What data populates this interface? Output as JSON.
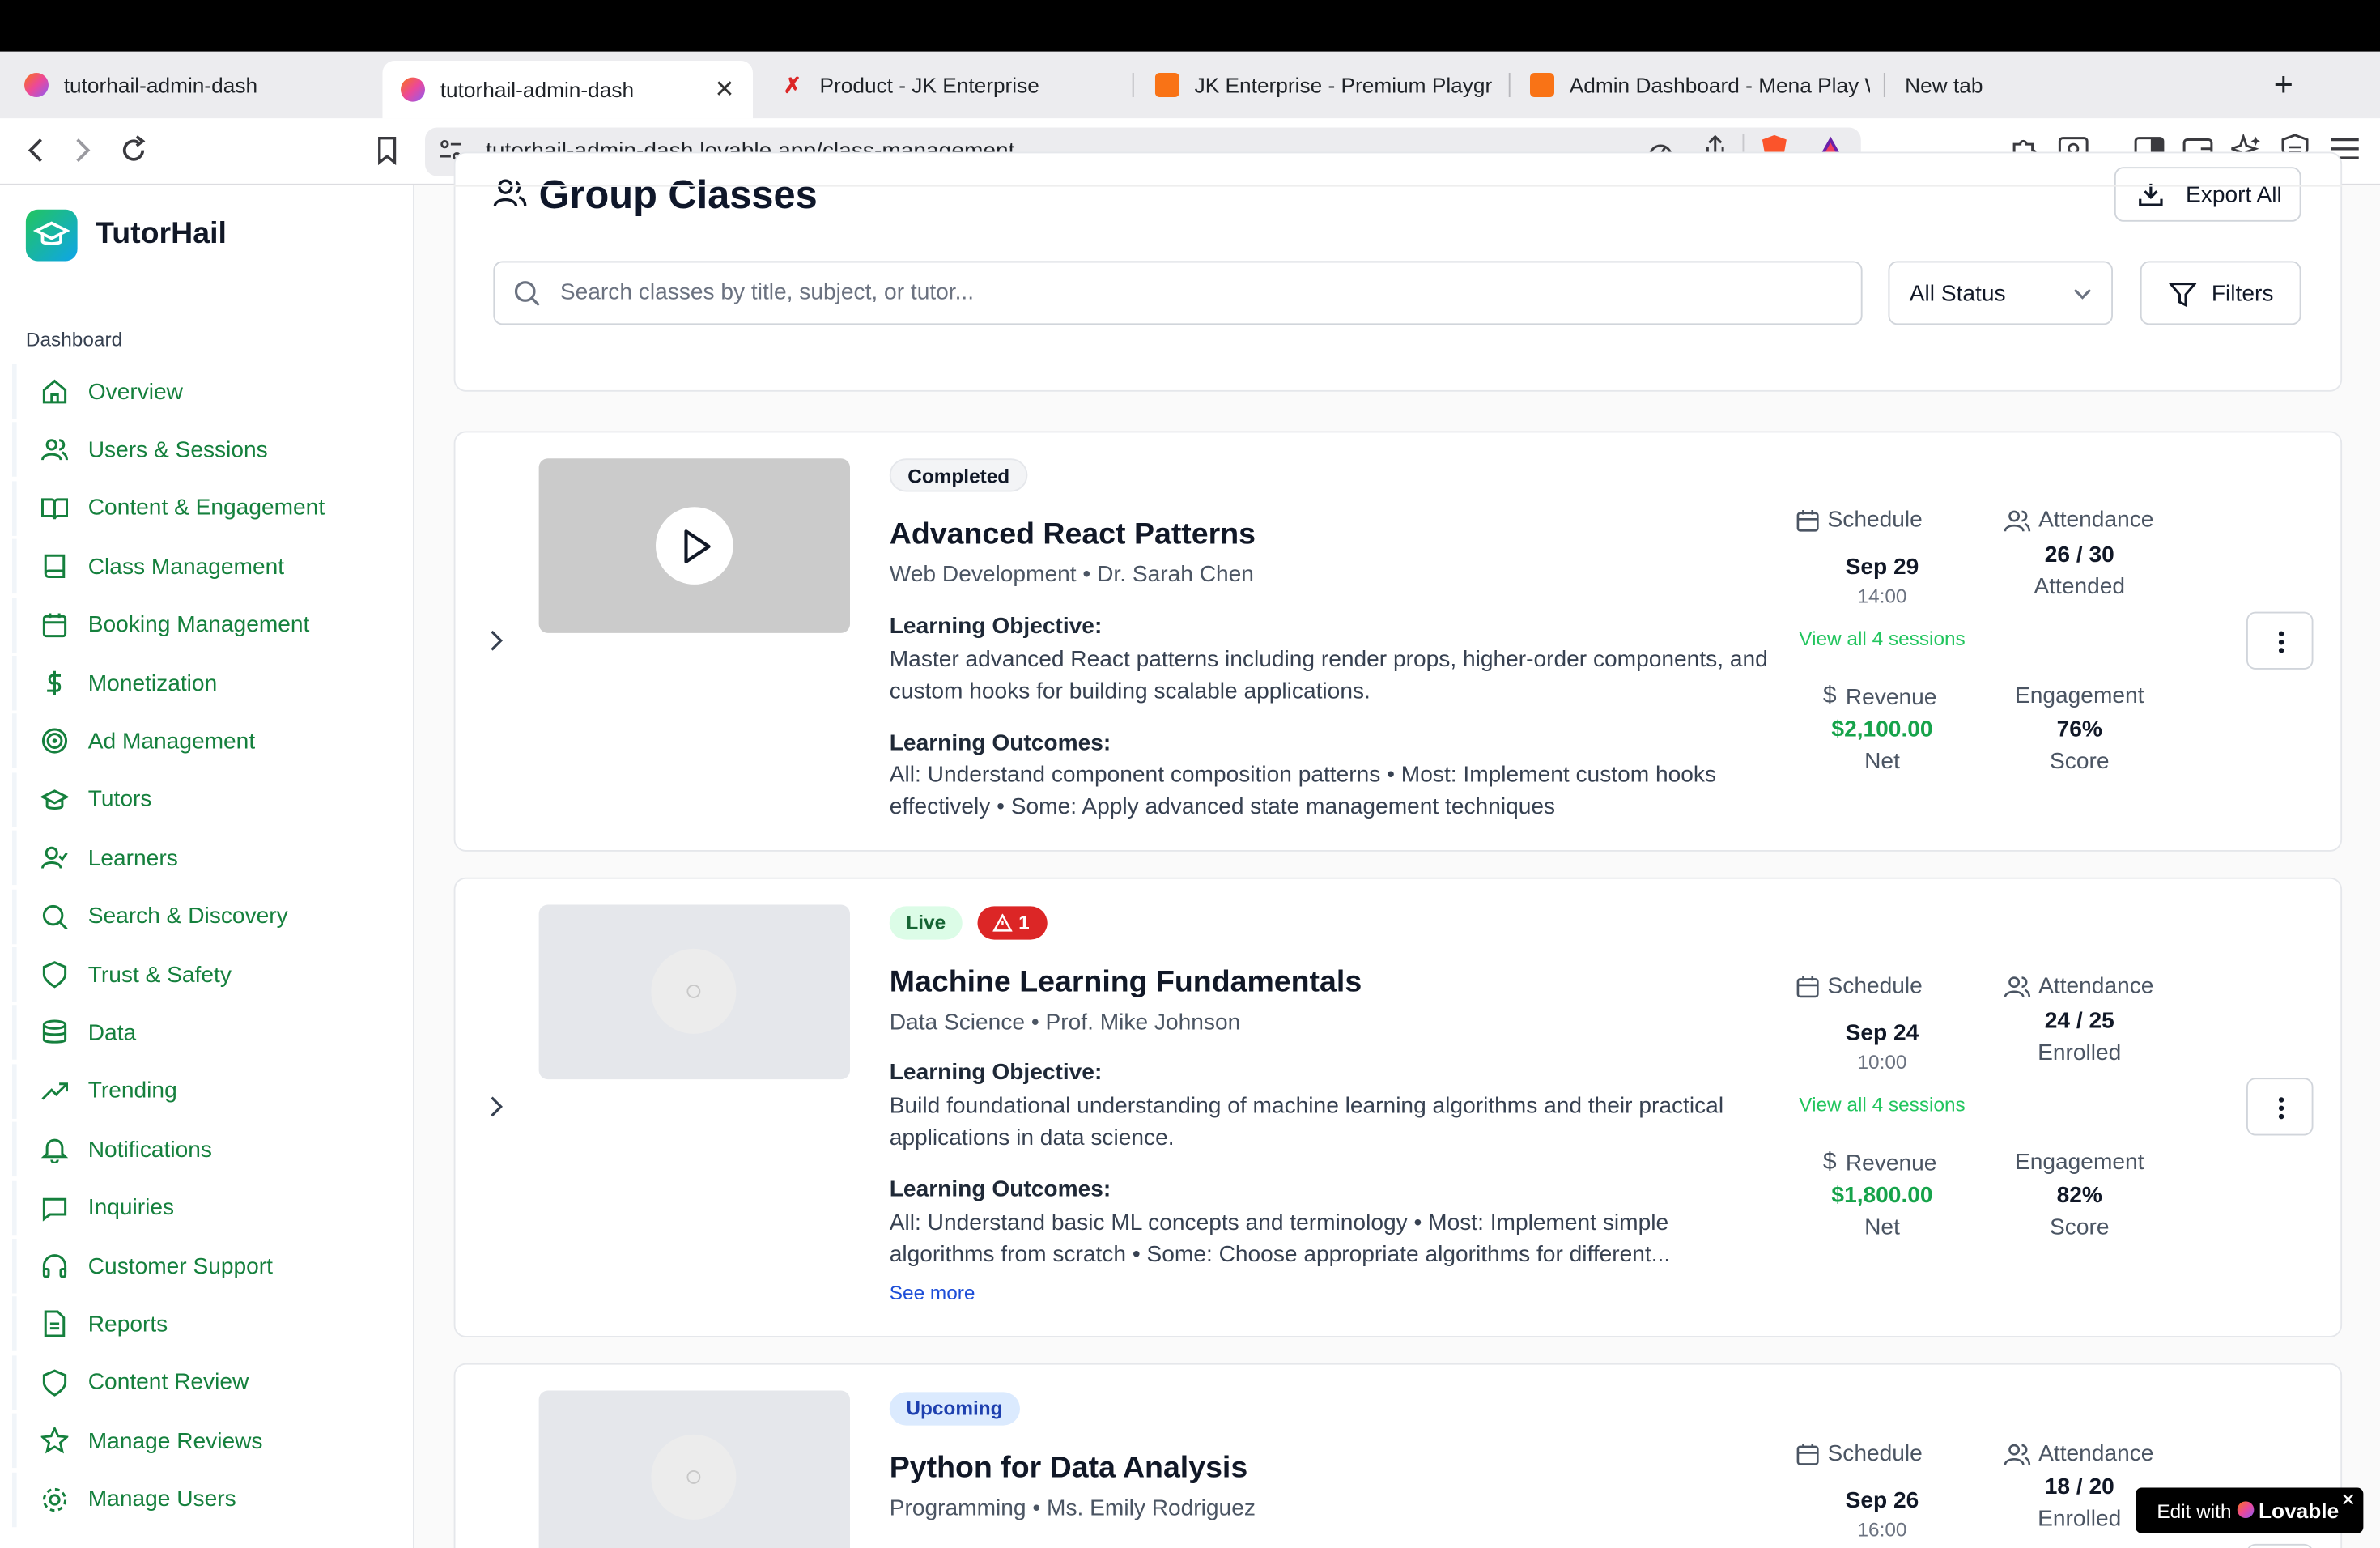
{
  "browser": {
    "tabs": [
      {
        "title": "tutorhail-admin-dash"
      },
      {
        "title": "tutorhail-admin-dash"
      },
      {
        "title": "Product - JK Enterprise"
      },
      {
        "title": "JK Enterprise - Premium Playgro"
      },
      {
        "title": "Admin Dashboard - Mena Play W"
      },
      {
        "title": "New tab"
      }
    ],
    "url": "tutorhail-admin-dash.lovable.app/class-management"
  },
  "sidebar": {
    "brand": "TutorHail",
    "section_label": "Dashboard",
    "items": [
      {
        "label": "Overview",
        "icon": "home-icon"
      },
      {
        "label": "Users & Sessions",
        "icon": "users-icon"
      },
      {
        "label": "Content & Engagement",
        "icon": "book-open-icon"
      },
      {
        "label": "Class Management",
        "icon": "book-icon"
      },
      {
        "label": "Booking Management",
        "icon": "calendar-icon"
      },
      {
        "label": "Monetization",
        "icon": "dollar-icon"
      },
      {
        "label": "Ad Management",
        "icon": "target-icon"
      },
      {
        "label": "Tutors",
        "icon": "graduation-cap-icon"
      },
      {
        "label": "Learners",
        "icon": "user-check-icon"
      },
      {
        "label": "Search & Discovery",
        "icon": "search-icon"
      },
      {
        "label": "Trust & Safety",
        "icon": "shield-icon"
      },
      {
        "label": "Data",
        "icon": "database-icon"
      },
      {
        "label": "Trending",
        "icon": "trending-up-icon"
      },
      {
        "label": "Notifications",
        "icon": "bell-icon"
      },
      {
        "label": "Inquiries",
        "icon": "message-square-icon"
      },
      {
        "label": "Customer Support",
        "icon": "headphones-icon"
      },
      {
        "label": "Reports",
        "icon": "file-text-icon"
      },
      {
        "label": "Content Review",
        "icon": "shield-icon"
      },
      {
        "label": "Manage Reviews",
        "icon": "star-icon"
      },
      {
        "label": "Manage Users",
        "icon": "gear-icon"
      }
    ]
  },
  "header": {
    "title": "Group Classes",
    "export_label": "Export All"
  },
  "filters": {
    "search_placeholder": "Search classes by title, subject, or tutor...",
    "status_value": "All Status",
    "filters_label": "Filters"
  },
  "labels": {
    "learning_objective": "Learning Objective:",
    "learning_outcomes": "Learning Outcomes:",
    "schedule": "Schedule",
    "attendance": "Attendance",
    "revenue": "Revenue",
    "engagement": "Engagement",
    "net": "Net",
    "score": "Score"
  },
  "classes": [
    {
      "status": "Completed",
      "title": "Advanced React Patterns",
      "subtitle": "Web Development • Dr. Sarah Chen",
      "objective": "Master advanced React patterns including render props, higher-order components, and custom hooks for building scalable applications.",
      "outcomes": "All: Understand component composition patterns • Most: Implement custom hooks effectively • Some: Apply advanced state management techniques",
      "schedule_date": "Sep 29",
      "schedule_time": "14:00",
      "sessions_link": "View all 4 sessions",
      "attendance_value": "26 / 30",
      "attendance_label": "Attended",
      "revenue": "$2,100.00",
      "engagement": "76%"
    },
    {
      "status": "Live",
      "alert_count": "1",
      "title": "Machine Learning Fundamentals",
      "subtitle": "Data Science • Prof. Mike Johnson",
      "objective": "Build foundational understanding of machine learning algorithms and their practical applications in data science.",
      "outcomes": "All: Understand basic ML concepts and terminology • Most: Implement simple algorithms from scratch • Some: Choose appropriate algorithms for different...",
      "see_more": "See more",
      "schedule_date": "Sep 24",
      "schedule_time": "10:00",
      "sessions_link": "View all 4 sessions",
      "attendance_value": "24 / 25",
      "attendance_label": "Enrolled",
      "revenue": "$1,800.00",
      "engagement": "82%"
    },
    {
      "status": "Upcoming",
      "title": "Python for Data Analysis",
      "subtitle": "Programming • Ms. Emily Rodriguez",
      "schedule_date": "Sep 26",
      "schedule_time": "16:00",
      "attendance_value": "18 / 20",
      "attendance_label": "Enrolled"
    }
  ],
  "lovable_badge": {
    "prefix": "Edit with",
    "brand": "Lovable"
  },
  "colors": {
    "accent": "#16a34a",
    "live_bg": "#dcfce7",
    "alert": "#dc2626",
    "upcoming_bg": "#dbeafe"
  }
}
